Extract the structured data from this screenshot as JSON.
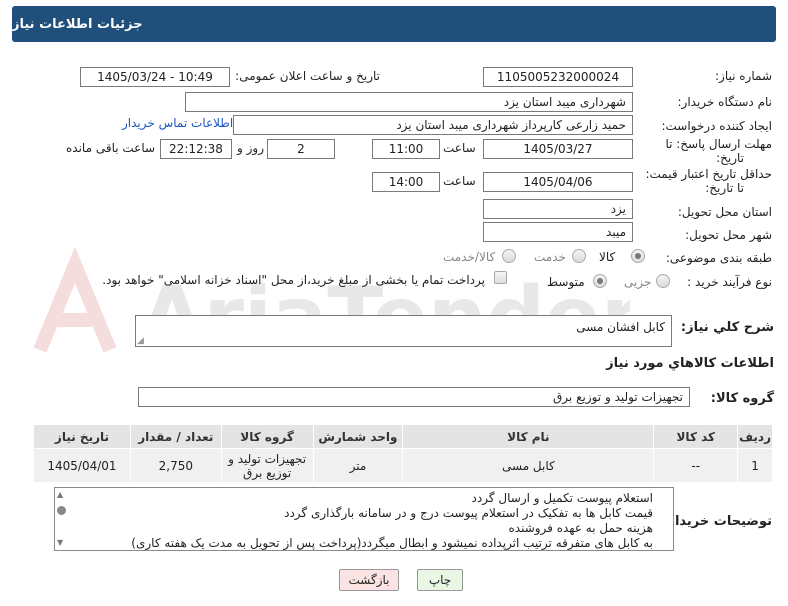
{
  "header": {
    "title": "جزئیات اطلاعات نیاز"
  },
  "form": {
    "need_number_label": "شماره نیاز:",
    "need_number": "1105005232000024",
    "announce_label": "تاریخ و ساعت اعلان عمومی:",
    "announce_value": "1405/03/24 - 10:49",
    "buyer_org_label": "نام دستگاه خریدار:",
    "buyer_org": "شهرداری میبد استان یزد",
    "creator_label": "ایجاد کننده درخواست:",
    "creator": "حمید زارعی کارپرداز شهرداری میبد استان یزد",
    "contact_link": "اطلاعات تماس خریدار",
    "deadline_label_1": "مهلت ارسال پاسخ: تا",
    "deadline_label_2": "تاریخ:",
    "deadline_date": "1405/03/27",
    "time_label": "ساعت",
    "deadline_time": "11:00",
    "days_value": "2",
    "days_label": "روز و",
    "remaining_value": "22:12:38",
    "remaining_label": "ساعت باقی مانده",
    "validity_label_1": "حداقل تاریخ اعتبار قیمت:",
    "validity_label_2": "تا تاریخ:",
    "validity_date": "1405/04/06",
    "validity_time": "14:00",
    "province_label": "استان محل تحویل:",
    "province": "یزد",
    "city_label": "شهر محل تحویل:",
    "city": "میبد",
    "category_label": "طبقه بندی موضوعی:",
    "category_options": {
      "goods": "کالا",
      "service": "خدمت",
      "goods_service": "کالا/خدمت"
    },
    "process_label": "نوع فرآیند خرید :",
    "process_options": {
      "minor": "جزیی",
      "medium": "متوسط"
    },
    "payment_note": "پرداخت تمام یا بخشی از مبلغ خرید،از محل \"اسناد خزانه اسلامی\" خواهد بود."
  },
  "description": {
    "label": "شرح کلي نياز:",
    "value": "کابل افشان مسی"
  },
  "goods_info": {
    "title": "اطلاعات کالاهاي مورد نياز",
    "group_label": "گروه کالا:",
    "group_value": "تجهیزات تولید و توزیع برق"
  },
  "table": {
    "headers": [
      "ردیف",
      "کد کالا",
      "نام کالا",
      "واحد شمارش",
      "گروه کالا",
      "تعداد / مقدار",
      "تاریخ نیاز"
    ],
    "rows": [
      [
        "1",
        "--",
        "کابل مسی",
        "متر",
        "تجهیزات تولید و توزیع برق",
        "2,750",
        "1405/04/01"
      ]
    ]
  },
  "buyer_notes": {
    "label": "توضیحات خریدار:",
    "lines": [
      "استعلام پیوست تکمیل و ارسال گردد",
      "قیمت کابل ها به تفکیک در استعلام پیوست درج و در سامانه بارگذاری گردد",
      "هزینه حمل به عهده فروشنده",
      "به کابل های متفرقه ترتیب اثرپداده نمیشود و ابطال میگردد(پرداخت پس از تحویل به مدت یک هفته کاری)"
    ]
  },
  "buttons": {
    "print": "چاپ",
    "back": "بازگشت"
  },
  "watermark": {
    "text": "AriaTender.net"
  },
  "colors": {
    "header_bg": "#1f4f7a",
    "back_button_bg": "#fbe3e3",
    "print_button_bg": "#e9f7e4"
  }
}
